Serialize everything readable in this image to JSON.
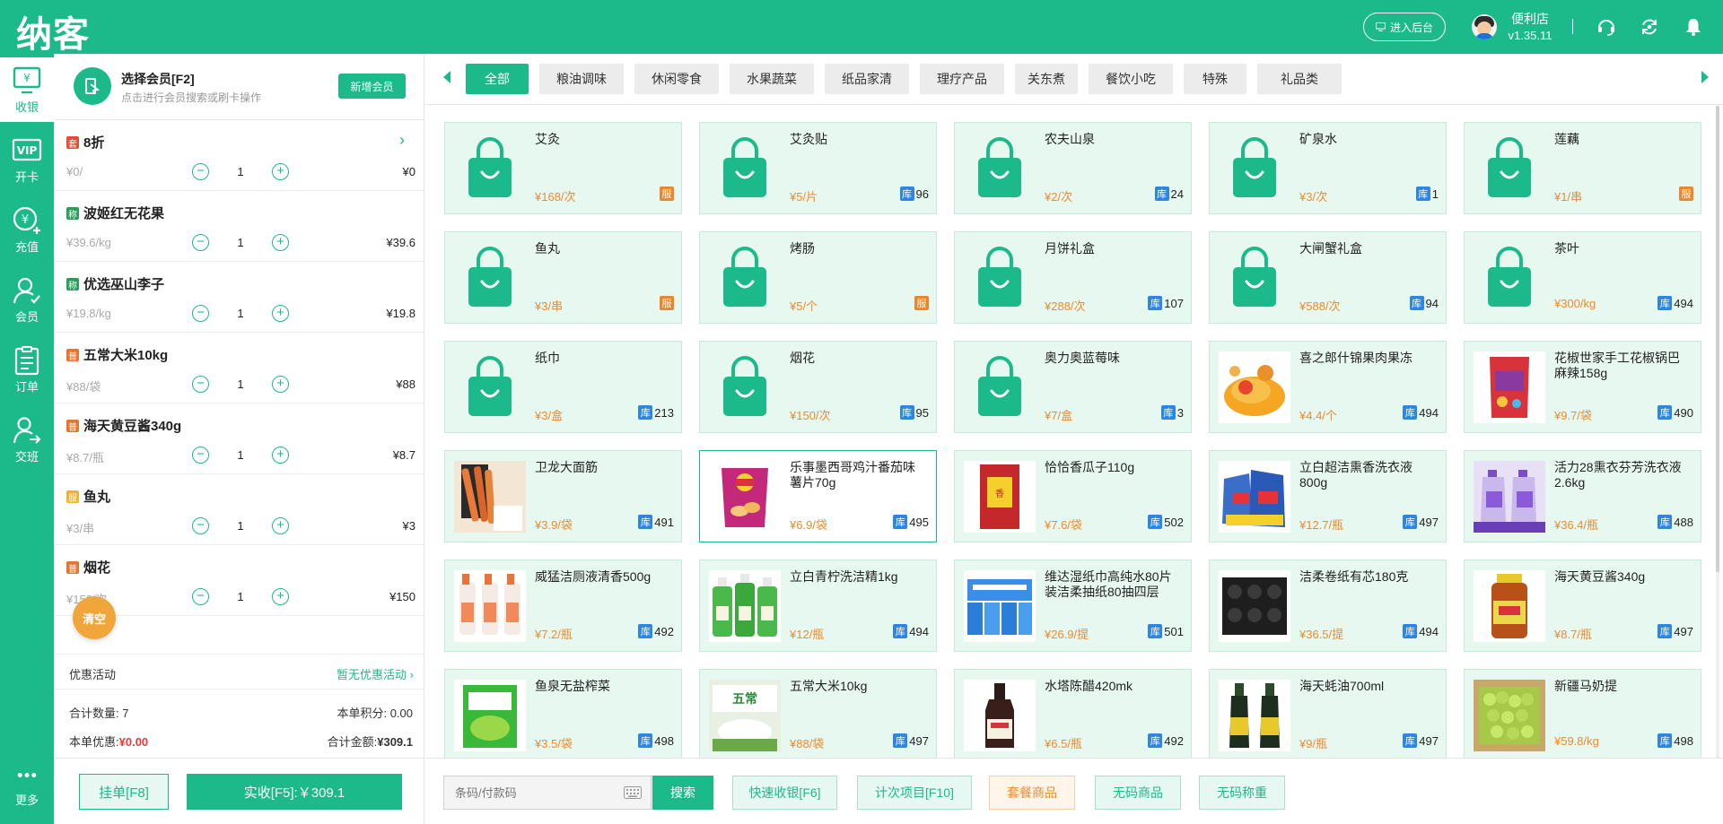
{
  "app": {
    "logo": "纳客",
    "backend_button": "进入后台",
    "shop_name": "便利店",
    "version": "v1.35.11"
  },
  "nav": [
    {
      "label": "收银",
      "icon": "cashier-icon",
      "active": true
    },
    {
      "label": "开卡",
      "icon": "vip-card-icon",
      "active": false
    },
    {
      "label": "充值",
      "icon": "recharge-icon",
      "active": false
    },
    {
      "label": "会员",
      "icon": "member-icon",
      "active": false
    },
    {
      "label": "订单",
      "icon": "order-icon",
      "active": false
    },
    {
      "label": "交班",
      "icon": "handover-icon",
      "active": false
    }
  ],
  "more": {
    "label": "更多"
  },
  "member": {
    "title": "选择会员[F2]",
    "subtitle": "点击进行会员搜索或刷卡操作",
    "add_button": "新增会员"
  },
  "cart_items": [
    {
      "tag": "套",
      "tag_color": "#e84a3a",
      "name": "8折",
      "price": "¥0/",
      "qty": "1",
      "subtotal": "¥0",
      "has_arrow": true
    },
    {
      "tag": "称",
      "tag_color": "#2a9d5c",
      "name": "波姬红无花果",
      "price": "¥39.6/kg",
      "qty": "1",
      "subtotal": "¥39.6"
    },
    {
      "tag": "称",
      "tag_color": "#2a9d5c",
      "name": "优选巫山李子",
      "price": "¥19.8/kg",
      "qty": "1",
      "subtotal": "¥19.8"
    },
    {
      "tag": "普",
      "tag_color": "#e8742b",
      "name": "五常大米10kg",
      "price": "¥88/袋",
      "qty": "1",
      "subtotal": "¥88"
    },
    {
      "tag": "普",
      "tag_color": "#e8742b",
      "name": "海天黄豆酱340g",
      "price": "¥8.7/瓶",
      "qty": "1",
      "subtotal": "¥8.7"
    },
    {
      "tag": "服",
      "tag_color": "#f0b22a",
      "name": "鱼丸",
      "price": "¥3/串",
      "qty": "1",
      "subtotal": "¥3"
    },
    {
      "tag": "普",
      "tag_color": "#e8742b",
      "name": "烟花",
      "price": "¥150/次",
      "qty": "1",
      "subtotal": "¥150"
    }
  ],
  "clear_button": "清空",
  "promo": {
    "label": "优惠活动",
    "value": "暂无优惠活动 ›"
  },
  "summary": {
    "qty_label": "合计数量:",
    "qty_value": "7",
    "points_label": "本单积分:",
    "points_value": "0.00",
    "discount_label": "本单优惠:",
    "discount_value": "¥0.00",
    "total_label": "合计金额:",
    "total_value": "¥309.1"
  },
  "footer": {
    "hold_button": "挂单[F8]",
    "pay_button": "实收[F5]:￥309.1"
  },
  "categories": [
    "全部",
    "粮油调味",
    "休闲零食",
    "水果蔬菜",
    "纸品家清",
    "理疗产品",
    "关东煮",
    "餐饮小吃",
    "特殊",
    "礼品类"
  ],
  "stock_label": "库",
  "service_label": "服",
  "products": [
    {
      "name": "艾灸",
      "price": "¥168/次",
      "badge": "service",
      "stock": "",
      "img": "bag"
    },
    {
      "name": "艾灸贴",
      "price": "¥5/片",
      "badge": "stock",
      "stock": "96",
      "img": "bag"
    },
    {
      "name": "农夫山泉",
      "price": "¥2/次",
      "badge": "stock",
      "stock": "24",
      "img": "bag"
    },
    {
      "name": "矿泉水",
      "price": "¥3/次",
      "badge": "stock",
      "stock": "1",
      "img": "bag"
    },
    {
      "name": "莲藕",
      "price": "¥1/串",
      "badge": "service",
      "stock": "",
      "img": "bag"
    },
    {
      "name": "鱼丸",
      "price": "¥3/串",
      "badge": "service",
      "stock": "",
      "img": "bag"
    },
    {
      "name": "烤肠",
      "price": "¥5/个",
      "badge": "service",
      "stock": "",
      "img": "bag"
    },
    {
      "name": "月饼礼盒",
      "price": "¥288/次",
      "badge": "stock",
      "stock": "107",
      "img": "bag"
    },
    {
      "name": "大闸蟹礼盒",
      "price": "¥588/次",
      "badge": "stock",
      "stock": "94",
      "img": "bag"
    },
    {
      "name": "茶叶",
      "price": "¥300/kg",
      "badge": "stock",
      "stock": "494",
      "img": "bag"
    },
    {
      "name": "纸巾",
      "price": "¥3/盒",
      "badge": "stock",
      "stock": "213",
      "img": "bag"
    },
    {
      "name": "烟花",
      "price": "¥150/次",
      "badge": "stock",
      "stock": "95",
      "img": "bag"
    },
    {
      "name": "奥力奥蓝莓味",
      "price": "¥7/盒",
      "badge": "stock",
      "stock": "3",
      "img": "bag"
    },
    {
      "name": "喜之郎什锦果肉果冻",
      "price": "¥4.4/个",
      "badge": "stock",
      "stock": "494",
      "img": "jelly"
    },
    {
      "name": "花椒世家手工花椒锅巴麻辣158g",
      "price": "¥9.7/袋",
      "badge": "stock",
      "stock": "490",
      "img": "snack"
    },
    {
      "name": "卫龙大面筋",
      "price": "¥3.9/袋",
      "badge": "stock",
      "stock": "491",
      "img": "gluten"
    },
    {
      "name": "乐事墨西哥鸡汁番茄味薯片70g",
      "price": "¥6.9/袋",
      "badge": "stock",
      "stock": "495",
      "img": "chips",
      "selected": true
    },
    {
      "name": "恰恰香瓜子110g",
      "price": "¥7.6/袋",
      "badge": "stock",
      "stock": "502",
      "img": "seeds"
    },
    {
      "name": "立白超洁熏香洗衣液800g",
      "price": "¥12.7/瓶",
      "badge": "stock",
      "stock": "497",
      "img": "detergent"
    },
    {
      "name": "活力28熏衣芬芳洗衣液2.6kg",
      "price": "¥36.4/瓶",
      "badge": "stock",
      "stock": "488",
      "img": "detergent2"
    },
    {
      "name": "威猛洁厕液清香500g",
      "price": "¥7.2/瓶",
      "badge": "stock",
      "stock": "492",
      "img": "bottles"
    },
    {
      "name": "立白青柠洗洁精1kg",
      "price": "¥12/瓶",
      "badge": "stock",
      "stock": "494",
      "img": "greenbottles"
    },
    {
      "name": "维达湿纸巾高纯水80片装洁柔抽纸80抽四层（...",
      "price": "¥26.9/提",
      "badge": "stock",
      "stock": "501",
      "img": "tissue"
    },
    {
      "name": "洁柔卷纸有芯180克",
      "price": "¥36.5/提",
      "badge": "stock",
      "stock": "494",
      "img": "rolls"
    },
    {
      "name": "海天黄豆酱340g",
      "price": "¥8.7/瓶",
      "badge": "stock",
      "stock": "497",
      "img": "sauce"
    },
    {
      "name": "鱼泉无盐榨菜",
      "price": "¥3.5/袋",
      "badge": "stock",
      "stock": "498",
      "img": "pickle"
    },
    {
      "name": "五常大米10kg",
      "price": "¥88/袋",
      "badge": "stock",
      "stock": "497",
      "img": "rice"
    },
    {
      "name": "水塔陈醋420mk",
      "price": "¥6.5/瓶",
      "badge": "stock",
      "stock": "492",
      "img": "vinegar"
    },
    {
      "name": "海天蚝油700ml",
      "price": "¥9/瓶",
      "badge": "stock",
      "stock": "497",
      "img": "oyster"
    },
    {
      "name": "新疆马奶提",
      "price": "¥59.8/kg",
      "badge": "stock",
      "stock": "498",
      "img": "grapes"
    }
  ],
  "actions": {
    "search_placeholder": "条码/付款码",
    "search_button": "搜索",
    "buttons": [
      {
        "label": "快速收银[F6]",
        "style": "green"
      },
      {
        "label": "计次项目[F10]",
        "style": "green"
      },
      {
        "label": "套餐商品",
        "style": "orange"
      },
      {
        "label": "无码商品",
        "style": "green"
      },
      {
        "label": "无码称重",
        "style": "green"
      }
    ]
  }
}
